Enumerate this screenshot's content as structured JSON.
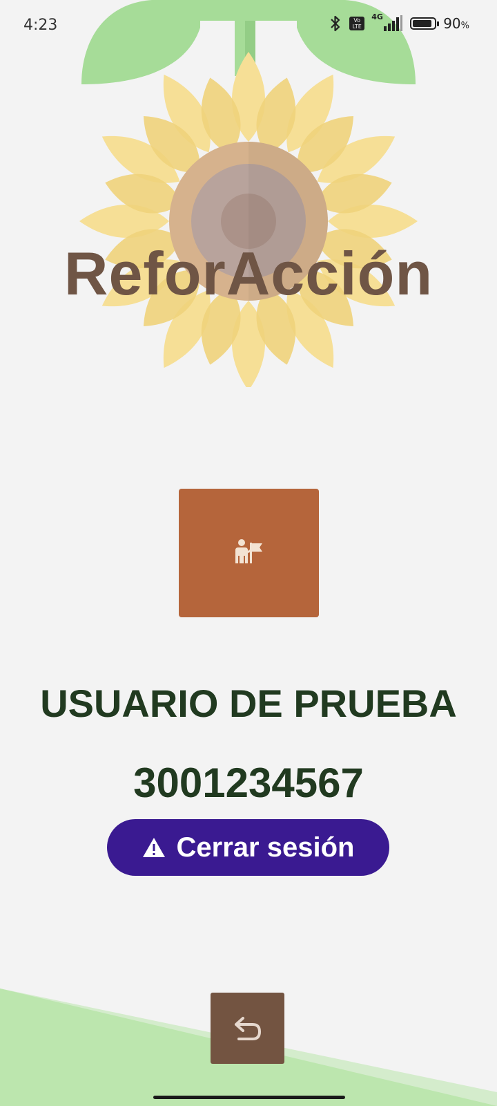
{
  "status_bar": {
    "time": "4:23",
    "volte_label": "Vo LTE",
    "network_label": "4G",
    "battery_percent": 90,
    "battery_text": "90",
    "percent_sign": "%"
  },
  "app": {
    "title": "ReforAcción"
  },
  "profile": {
    "icon": "person-with-flag-icon",
    "name": "USUARIO DE PRUEBA",
    "phone": "3001234567"
  },
  "logout": {
    "icon": "warning-icon",
    "label": "Cerrar sesión"
  },
  "navigation": {
    "back_icon": "return-arrow-icon"
  },
  "colors": {
    "background": "#f3f3f3",
    "title": "#6f5545",
    "profile_card": "#b5653b",
    "text_dark_green": "#213a20",
    "logout_button": "#3a1a91",
    "back_button": "#735441",
    "leaf_green": "#a6dc98",
    "petal_yellow": "#f3d98b"
  }
}
